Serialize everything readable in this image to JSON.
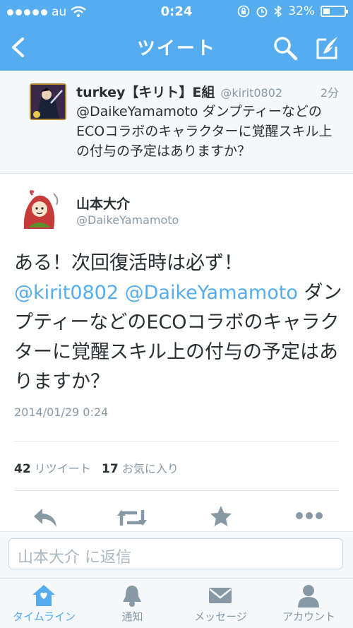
{
  "status_bar": {
    "carrier": "au",
    "time": "0:24",
    "battery": "32%",
    "battery_level": 0.32
  },
  "nav": {
    "title": "ツイート",
    "back_icon": "back-chevron-icon",
    "search_icon": "search-icon",
    "compose_icon": "compose-icon"
  },
  "parent_tweet": {
    "name": "turkey【キリト】E組",
    "handle": "@kirit0802",
    "time": "2分",
    "text": "@DaikeYamamoto ダンプティーなどのECOコラボのキャラクターに覚醒スキル上の付与の予定はありますか？"
  },
  "main_tweet": {
    "name": "山本大介",
    "handle": "@DaikeYamamoto",
    "text_intro": "ある！次回復活時は必ず！",
    "mention1": "@kirit0802",
    "mention2": "@DaikeYamamoto",
    "text_rest": "ダンプティーなどのECOコラボのキャラクターに覚醒スキル上の付与の予定はありますか？",
    "date": "2014/01/29 0:24"
  },
  "stats": {
    "retweets_count": "42",
    "retweets_label": "リツイート",
    "favorites_count": "17",
    "favorites_label": "お気に入り"
  },
  "reply": {
    "placeholder": "山本大介 に返信"
  },
  "tabs": [
    {
      "label": "タイムライン",
      "icon": "home-icon",
      "active": true
    },
    {
      "label": "通知",
      "icon": "bell-icon",
      "active": false
    },
    {
      "label": "メッセージ",
      "icon": "envelope-icon",
      "active": false
    },
    {
      "label": "アカウント",
      "icon": "person-icon",
      "active": false
    }
  ],
  "colors": {
    "brand": "#55acee",
    "text": "#292f33",
    "muted": "#8899a6"
  }
}
